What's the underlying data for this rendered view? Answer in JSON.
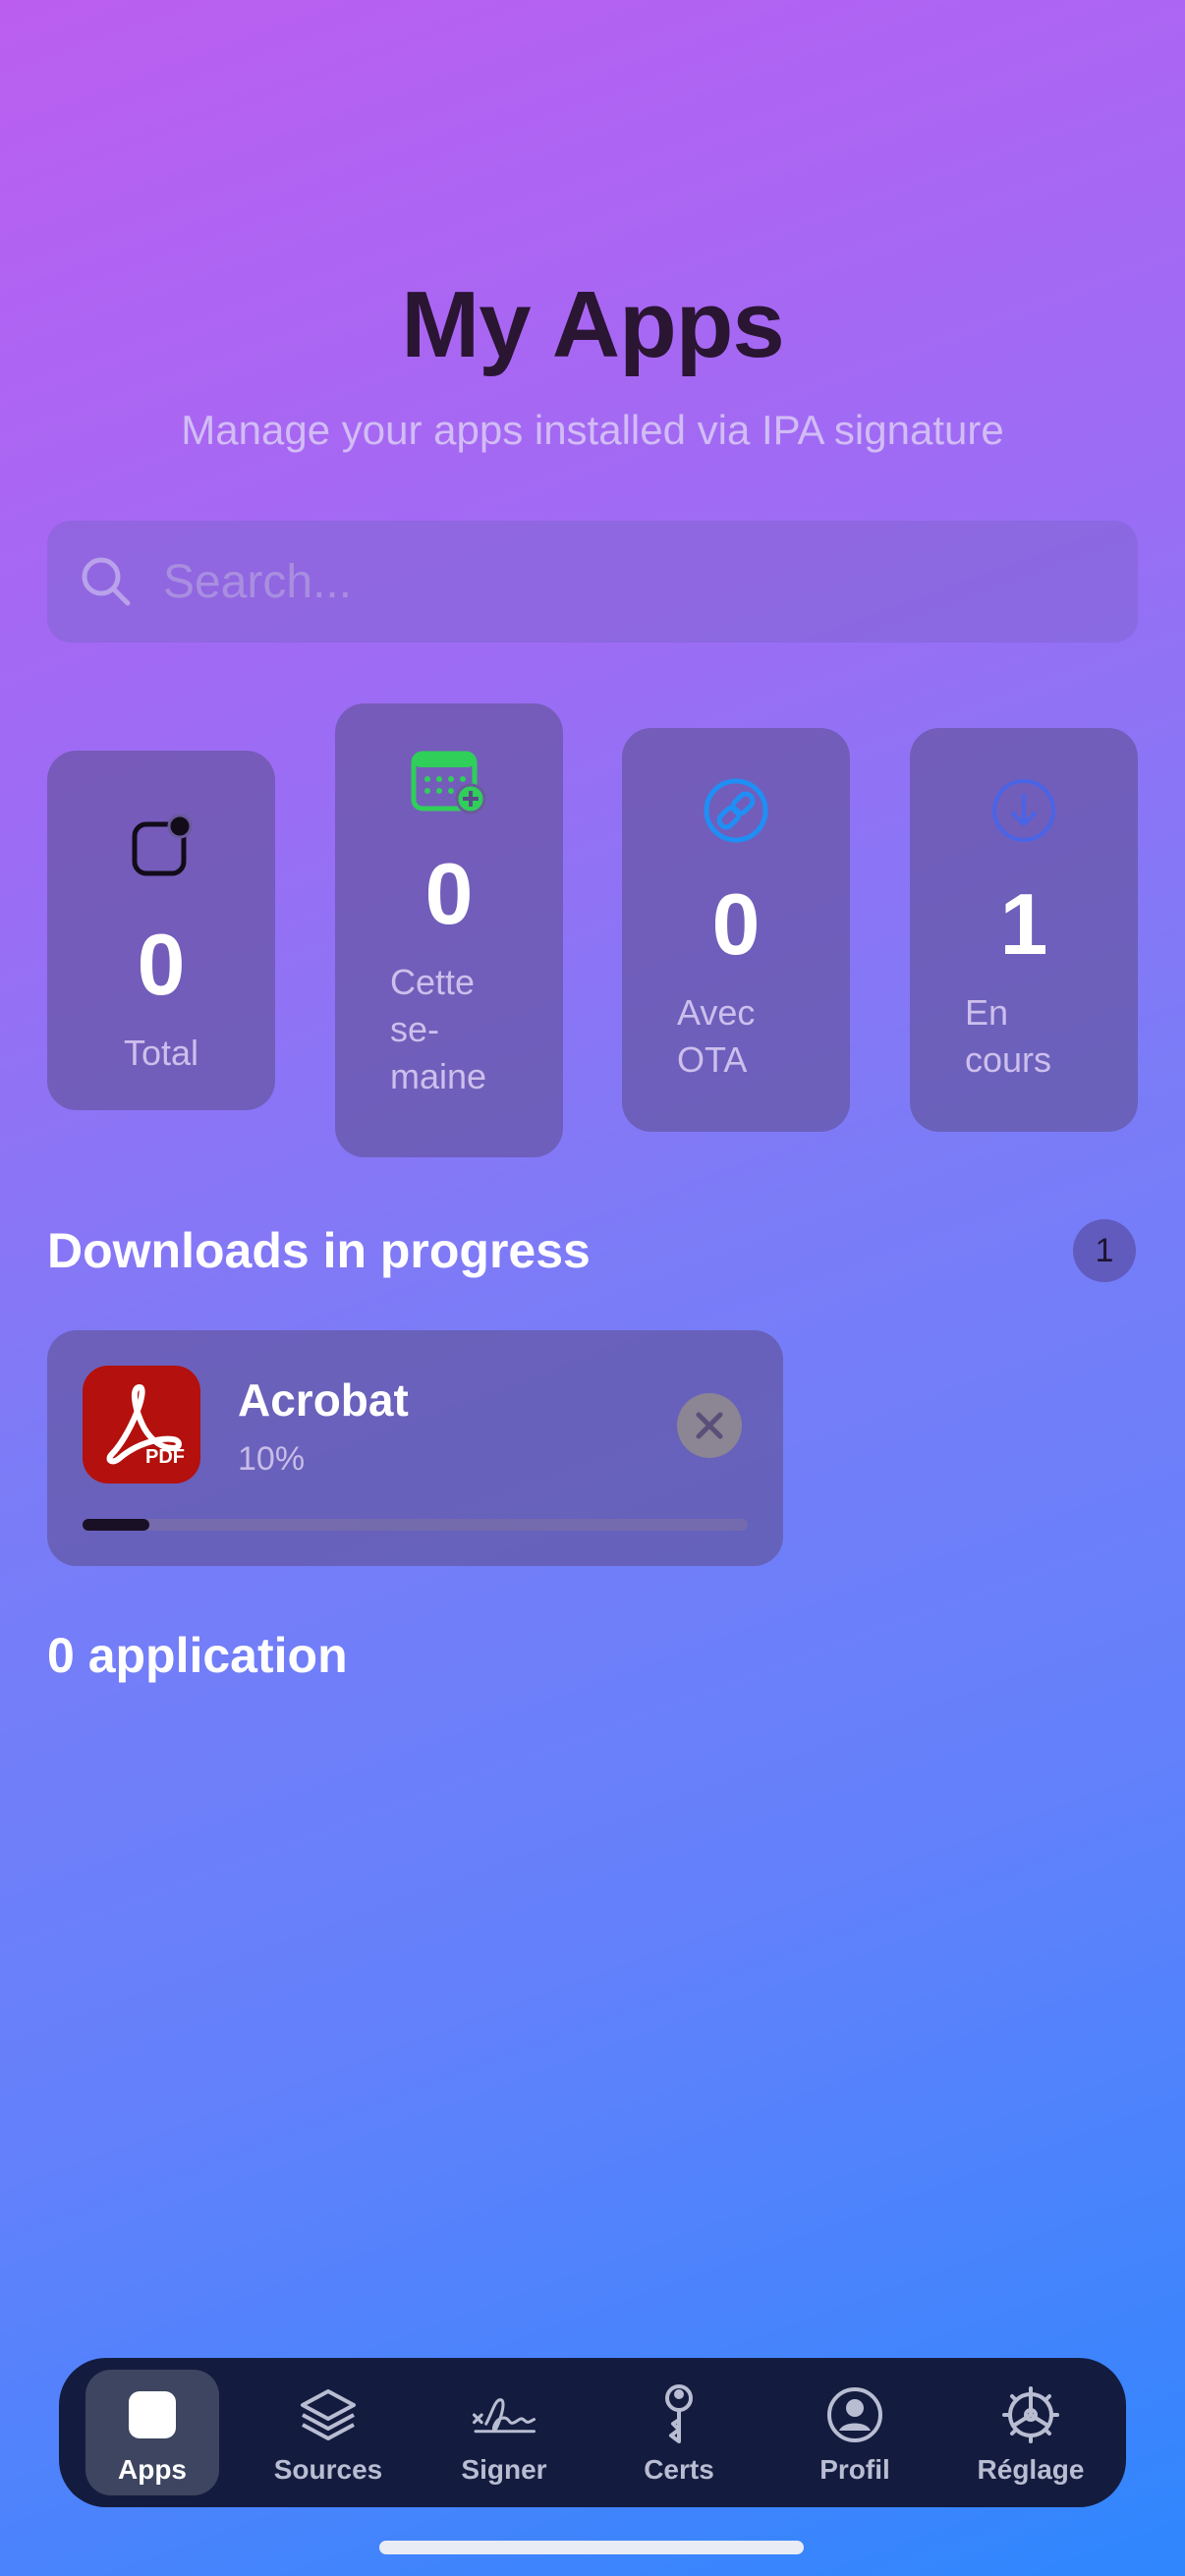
{
  "header": {
    "title": "My Apps",
    "subtitle": "Manage your apps installed via IPA signature"
  },
  "search": {
    "placeholder": "Search..."
  },
  "stats": [
    {
      "value": "0",
      "label": "Total",
      "icon": "app-badge-icon"
    },
    {
      "value": "0",
      "label": "Cette se-maine",
      "label_lines": [
        "Cette",
        "se-",
        "maine"
      ],
      "icon": "calendar-plus-icon",
      "icon_color": "#2fcf5a"
    },
    {
      "value": "0",
      "label": "Avec OTA",
      "label_lines": [
        "Avec",
        "OTA"
      ],
      "icon": "link-circle-icon",
      "icon_color": "#1f8ff5"
    },
    {
      "value": "1",
      "label": "En cours",
      "label_lines": [
        "En",
        "cours"
      ],
      "icon": "download-circle-icon",
      "icon_color": "#4a64e6"
    }
  ],
  "downloads": {
    "title": "Downloads in progress",
    "count": "1",
    "items": [
      {
        "name": "Acrobat",
        "percent_label": "10%",
        "progress": 0.1,
        "icon_text": "PDF",
        "icon": "acrobat-pdf-icon"
      }
    ]
  },
  "apps_section": {
    "title": "0 application"
  },
  "tabbar": {
    "tabs": [
      {
        "label": "Apps",
        "icon": "app-square-icon",
        "active": true
      },
      {
        "label": "Sources",
        "icon": "layers-icon",
        "active": false
      },
      {
        "label": "Signer",
        "icon": "signature-icon",
        "active": false
      },
      {
        "label": "Certs",
        "icon": "key-icon",
        "active": false
      },
      {
        "label": "Profil",
        "icon": "person-circle-icon",
        "active": false
      },
      {
        "label": "Réglage",
        "icon": "gear-icon",
        "active": false
      }
    ]
  },
  "colors": {
    "accent_green": "#2fcf5a",
    "accent_blue": "#1f8ff5",
    "acrobat_red": "#b4100d",
    "tabbar_bg": "#131c3f"
  }
}
